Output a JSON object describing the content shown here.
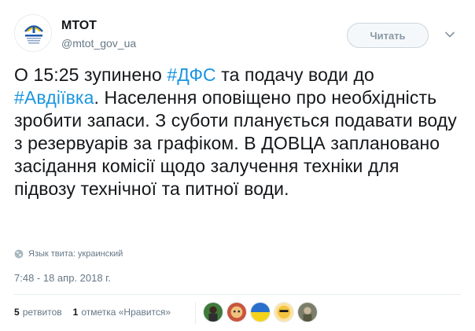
{
  "account": {
    "name": "МТОТ",
    "handle": "@mtot_gov_ua",
    "avatar_icon": "ministry-logo-icon"
  },
  "actions": {
    "follow_label": "Читать",
    "more_icon": "chevron-down-icon"
  },
  "tweet": {
    "text_1": "О 15:25 зупинено ",
    "hashtag_1": "#ДФС",
    "text_2": " та подачу води до ",
    "hashtag_2": "#Авдіївка",
    "text_3": ". Населення оповіщено про необхідність зробити запаси. З суботи планується подавати воду з резервуарів за графіком. В ДОВЦА заплановано засідання комісії щодо залучення техніки для підвозу технічної та питної води."
  },
  "language_label": "Язык твита: украинский",
  "timestamp": "7:48 - 18 апр. 2018 г.",
  "stats": {
    "retweets_count": "5",
    "retweets_label": "ретвитов",
    "likes_count": "1",
    "likes_label": "отметка «Нравится»"
  },
  "colors": {
    "hashtag": "#1b95e0",
    "secondary_text": "#657786",
    "border": "#e6ecf0"
  }
}
